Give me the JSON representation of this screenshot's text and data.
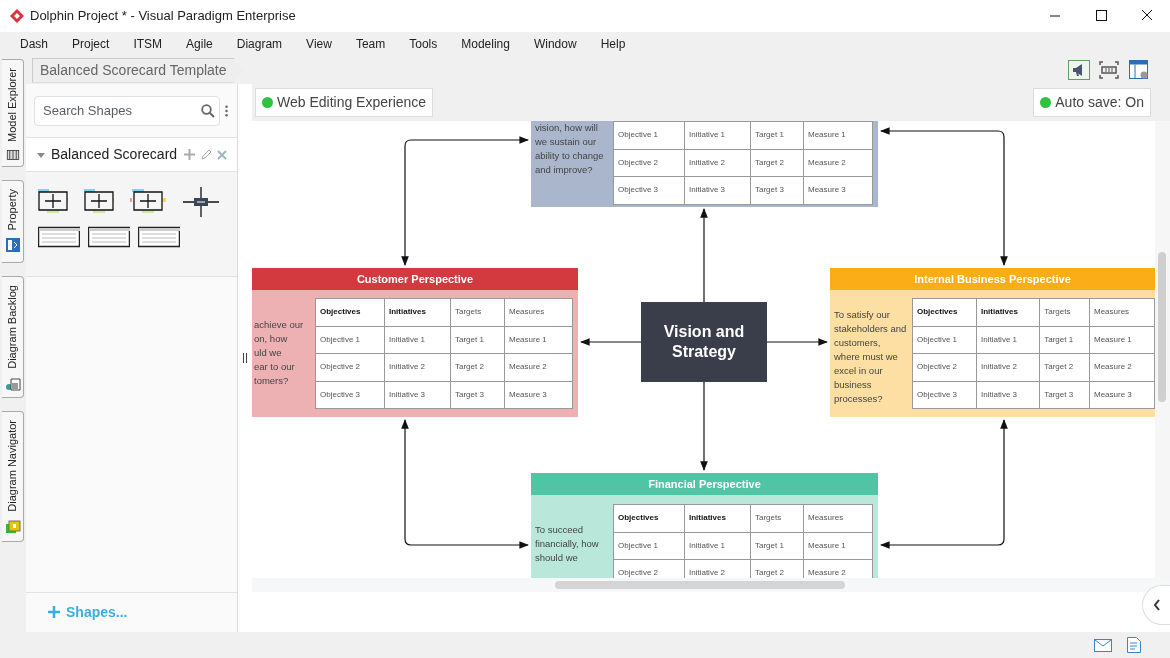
{
  "window": {
    "title": "Dolphin Project * - Visual Paradigm Enterprise"
  },
  "menu": [
    "Dash",
    "Project",
    "ITSM",
    "Agile",
    "Diagram",
    "View",
    "Team",
    "Tools",
    "Modeling",
    "Window",
    "Help"
  ],
  "side_tabs": [
    {
      "label": "Model Explorer",
      "kind": "explorer"
    },
    {
      "label": "Property",
      "kind": "property"
    },
    {
      "label": "Diagram Backlog",
      "kind": "backlog"
    },
    {
      "label": "Diagram Navigator",
      "kind": "navigator"
    }
  ],
  "breadcrumb": "Balanced Scorecard Template",
  "shape_search": {
    "placeholder": "Search Shapes"
  },
  "shape_group": {
    "title": "Balanced Scorecard",
    "expanded": true
  },
  "more_shapes": "Shapes...",
  "web_editing": "Web Editing Experience",
  "auto_save": "Auto save: On",
  "diagram": {
    "center": "Vision and Strategy",
    "perspectives": [
      {
        "kind": "learning",
        "color": "#aab6cc",
        "lines": [
          "vision, how will",
          "we sustain our",
          "ability to change",
          "and improve?"
        ],
        "rows": [
          [
            "Objective 1",
            "Initiative 1",
            "Target 1",
            "Measure 1"
          ],
          [
            "Objective 2",
            "Initiative 2",
            "Target 2",
            "Measure 2"
          ],
          [
            "Objective 3",
            "Initiative 3",
            "Target 3",
            "Measure 3"
          ]
        ]
      },
      {
        "kind": "customer",
        "title": "Customer Perspective",
        "color": "#d33a40",
        "lines": [
          "achieve our",
          "on, how",
          "uld we",
          "ear to our",
          "tomers?"
        ],
        "columns": [
          {
            "label": "Objectives",
            "bold": true
          },
          {
            "label": "Initiatives",
            "bold": true
          },
          {
            "label": "Targets",
            "bold": false
          },
          {
            "label": "Measures",
            "bold": false
          }
        ],
        "rows": [
          [
            "Objective 1",
            "Initiative 1",
            "Target 1",
            "Measure 1"
          ],
          [
            "Objective 2",
            "Initiative 2",
            "Target 2",
            "Measure 2"
          ],
          [
            "Objective 3",
            "Initiative 3",
            "Target 3",
            "Measure 3"
          ]
        ]
      },
      {
        "kind": "internal",
        "title": "Internal Business Perspective",
        "color": "#fbad18",
        "lines": [
          "To satisfy our",
          "stakeholders and",
          "customers,",
          "where must we",
          "excel in our",
          "business",
          "processes?"
        ],
        "columns": [
          {
            "label": "Objectives",
            "bold": true
          },
          {
            "label": "Initiatives",
            "bold": true
          },
          {
            "label": "Targets",
            "bold": false
          },
          {
            "label": "Measures",
            "bold": false
          }
        ],
        "rows": [
          [
            "Objective 1",
            "Initiative 1",
            "Target 1",
            "Measure 1"
          ],
          [
            "Objective 2",
            "Initiative 2",
            "Target 2",
            "Measure 2"
          ],
          [
            "Objective 3",
            "Initiative 3",
            "Target 3",
            "Measure 3"
          ]
        ]
      },
      {
        "kind": "financial",
        "title": "Financial Perspective",
        "color": "#4fc5a5",
        "lines": [
          "To succeed",
          "financially, how",
          "should we"
        ],
        "columns": [
          {
            "label": "Objectives",
            "bold": true
          },
          {
            "label": "Initiatives",
            "bold": true
          },
          {
            "label": "Targets",
            "bold": false
          },
          {
            "label": "Measures",
            "bold": false
          }
        ],
        "rows": [
          [
            "Objective 1",
            "Initiative 1",
            "Target 1",
            "Measure 1"
          ],
          [
            "Objective 2",
            "Initiative 2",
            "Target 2",
            "Measure 2"
          ]
        ]
      }
    ]
  }
}
